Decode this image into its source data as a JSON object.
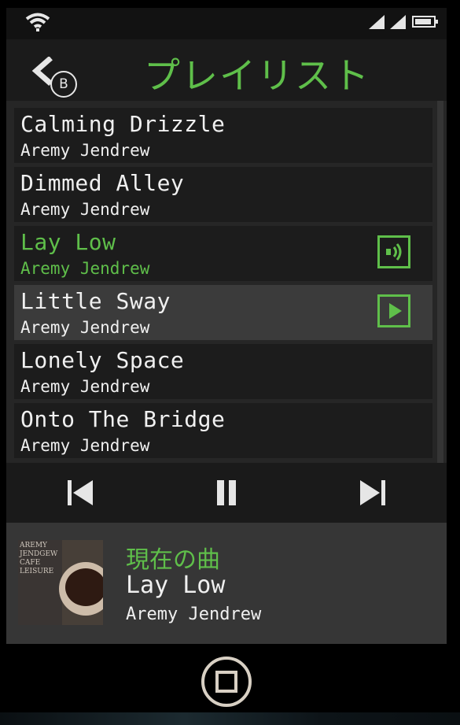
{
  "status_bar": {
    "icons": [
      "wifi-icon",
      "signal-icon",
      "signal-icon",
      "battery-icon"
    ]
  },
  "header": {
    "title": "プレイリスト",
    "back_button": {
      "icon": "chevron-left-icon",
      "badge": "B"
    }
  },
  "playlist": {
    "tracks": [
      {
        "title": "Calming Drizzle",
        "artist": "Aremy Jendrew"
      },
      {
        "title": "Dimmed Alley",
        "artist": "Aremy Jendrew"
      },
      {
        "title": "Lay Low",
        "artist": "Aremy Jendrew",
        "state": "playing",
        "icon": "speaker-icon"
      },
      {
        "title": "Little Sway",
        "artist": "Aremy Jendrew",
        "state": "selected",
        "icon": "play-icon"
      },
      {
        "title": "Lonely Space",
        "artist": "Aremy Jendrew"
      },
      {
        "title": "Onto The Bridge",
        "artist": "Aremy Jendrew"
      }
    ]
  },
  "controls": {
    "icons": [
      "previous-icon",
      "pause-icon",
      "next-icon"
    ]
  },
  "now_playing": {
    "label": "現在の曲",
    "title": "Lay Low",
    "artist": "Aremy Jendrew",
    "album_art_text": "AREMY\nJENDGEW\nCAFE\nLEISURE"
  },
  "home_button": {
    "icon": "home-icon"
  },
  "colors": {
    "accent": "#5fbf4a",
    "text": "#f0f0f0",
    "background": "#121212",
    "row": "#1c1c1c",
    "row_selected": "#3b3b3b",
    "now_playing_panel": "#363636"
  }
}
